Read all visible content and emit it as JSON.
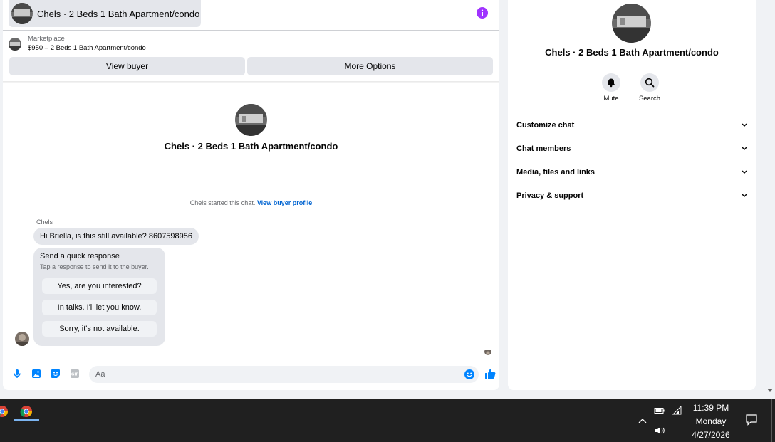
{
  "chat": {
    "header_title": "Chels · 2 Beds 1 Bath Apartment/condo",
    "marketplace_source": "Marketplace",
    "marketplace_listing": "$950 – 2 Beds 1 Bath Apartment/condo",
    "view_buyer_label": "View buyer",
    "more_options_label": "More Options",
    "center_name": "Chels · 2 Beds 1 Bath Apartment/condo",
    "system_text": "Chels started this chat.",
    "system_link": "View buyer profile",
    "sender_name": "Chels",
    "message": "Hi Briella, is this still available? 8607598956",
    "quick": {
      "title": "Send a quick response",
      "subtitle": "Tap a response to send it to the buyer.",
      "options": [
        "Yes, are you interested?",
        "In talks. I'll let you know.",
        "Sorry, it's not available."
      ]
    },
    "composer_placeholder": "Aa"
  },
  "info": {
    "name": "Chels · 2 Beds 1 Bath Apartment/condo",
    "mute_label": "Mute",
    "search_label": "Search",
    "sections": [
      "Customize chat",
      "Chat members",
      "Media, files and links",
      "Privacy & support"
    ]
  },
  "taskbar": {
    "time": "11:39 PM",
    "day": "Monday",
    "date": "4/27/2026"
  },
  "colors": {
    "accent_blue": "#0084ff",
    "info_purple": "#a033ff",
    "link_blue": "#0064d1"
  }
}
